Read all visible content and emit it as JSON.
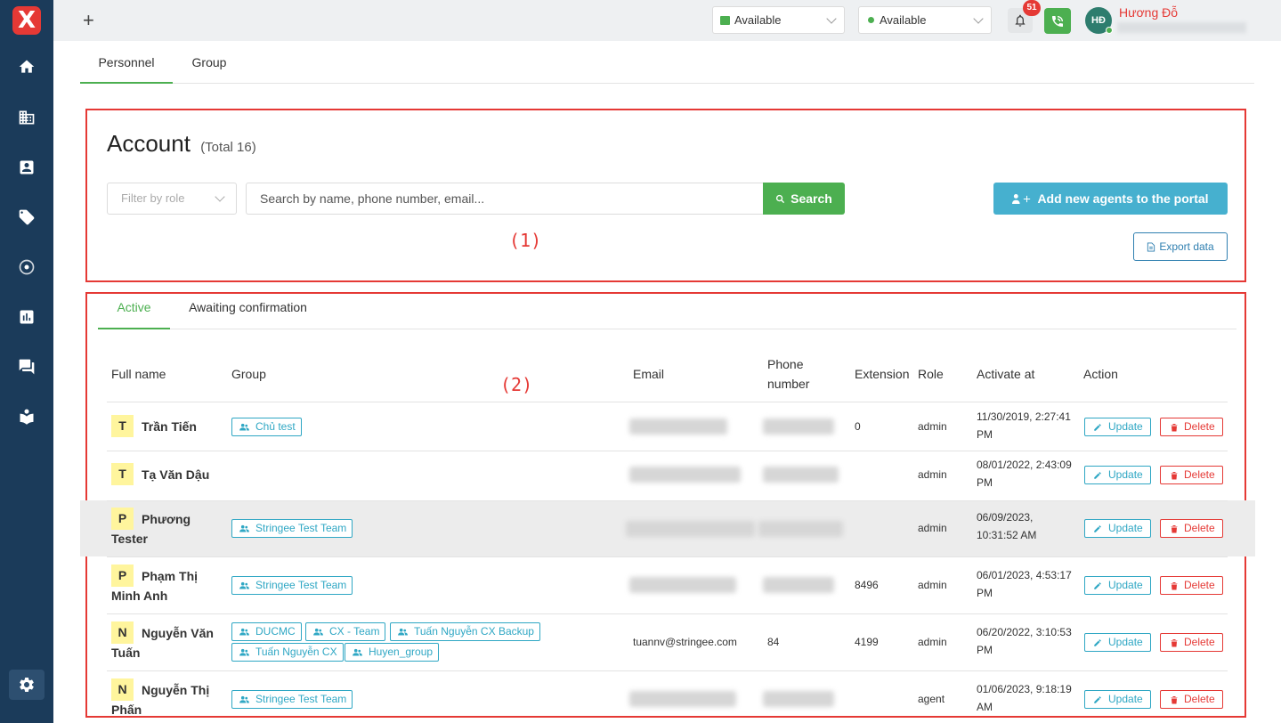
{
  "sidebar": {
    "logo": "X",
    "items": [
      "home-icon",
      "building-icon",
      "contact-card-icon",
      "tag-icon",
      "target-icon",
      "chart-icon",
      "chat-icon",
      "book-icon",
      "settings-icon"
    ]
  },
  "header": {
    "chat_status": "Available",
    "call_status": "Available",
    "notification_count": "51",
    "user_initials": "HĐ",
    "user_name": "Hương Đỗ"
  },
  "top_tabs": [
    "Personnel",
    "Group"
  ],
  "account": {
    "title": "Account",
    "total": "(Total 16)",
    "filter_placeholder": "Filter by role",
    "search_placeholder": "Search by name, phone number, email...",
    "search_label": "Search",
    "add_label": "Add new agents to the portal",
    "export_label": "Export data"
  },
  "annotations": {
    "box1": "(1)",
    "box2": "(2)"
  },
  "sub_tabs": [
    "Active",
    "Awaiting confirmation"
  ],
  "table": {
    "headers": {
      "full_name": "Full name",
      "group": "Group",
      "email": "Email",
      "phone_1": "Phone",
      "phone_2": "number",
      "extension": "Extension",
      "role": "Role",
      "activate_at": "Activate at",
      "action": "Action"
    },
    "update_label": "Update",
    "delete_label": "Delete",
    "rows": [
      {
        "initial": "T",
        "name_1": "Trần Tiến",
        "name_2": "",
        "groups": [
          "Chủ test"
        ],
        "email": "",
        "phone": "",
        "extension": "0",
        "role": "admin",
        "activate_1": "11/30/2019, 2:27:41",
        "activate_2": "PM"
      },
      {
        "initial": "T",
        "name_1": "Tạ Văn Dậu",
        "name_2": "",
        "groups": [],
        "email": "",
        "phone": "",
        "extension": "",
        "role": "admin",
        "activate_1": "08/01/2022, 2:43:09",
        "activate_2": "PM"
      },
      {
        "initial": "P",
        "name_1": "Phương",
        "name_2": "Tester",
        "groups": [
          "Stringee Test Team"
        ],
        "email": "",
        "phone": "",
        "extension": "",
        "role": "admin",
        "activate_1": "06/09/2023,",
        "activate_2": "10:31:52 AM"
      },
      {
        "initial": "P",
        "name_1": "Phạm Thị",
        "name_2": "Minh Anh",
        "groups": [
          "Stringee Test Team"
        ],
        "email": "",
        "phone": "",
        "extension": "8496",
        "role": "admin",
        "activate_1": "06/01/2023, 4:53:17",
        "activate_2": "PM"
      },
      {
        "initial": "N",
        "name_1": "Nguyễn Văn",
        "name_2": "Tuấn",
        "groups": [
          "DUCMC",
          "CX - Team",
          "Tuấn Nguyễn CX Backup",
          "Tuấn Nguyễn CX",
          "Huyen_group"
        ],
        "email": "tuannv@stringee.com",
        "phone": "84",
        "extension": "4199",
        "role": "admin",
        "activate_1": "06/20/2022, 3:10:53",
        "activate_2": "PM"
      },
      {
        "initial": "N",
        "name_1": "Nguyễn Thị",
        "name_2": "Phấn",
        "groups": [
          "Stringee Test Team"
        ],
        "email": "",
        "phone": "",
        "extension": "",
        "role": "agent",
        "activate_1": "01/06/2023, 9:18:19",
        "activate_2": "AM"
      }
    ]
  }
}
